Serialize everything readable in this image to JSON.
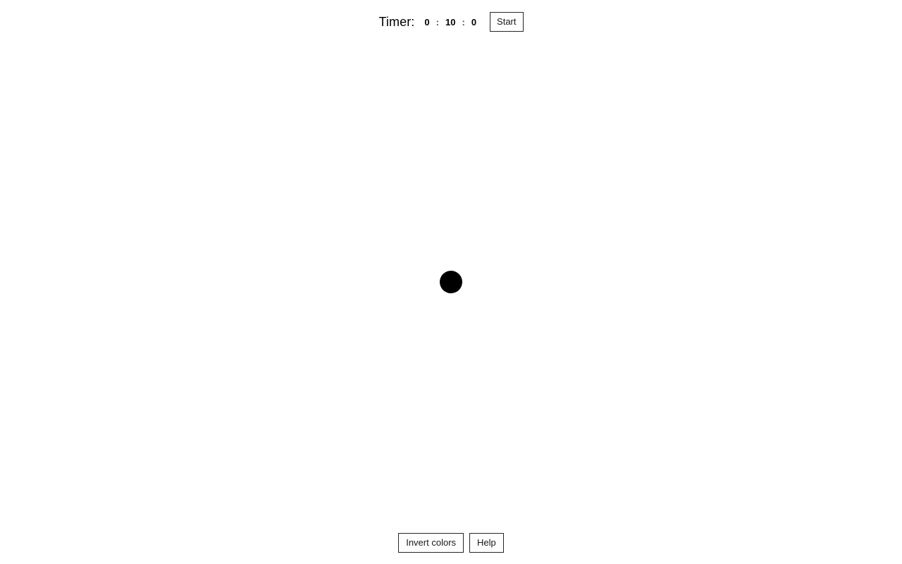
{
  "app": {
    "background_color": "#ffffff",
    "foreground_color": "#000000"
  },
  "timer": {
    "label": "Timer:",
    "hours": "0",
    "separator_1": ":",
    "minutes": "10",
    "separator_2": ":",
    "seconds": "0",
    "start_label": "Start"
  },
  "canvas": {
    "dot": {
      "color": "#000000",
      "diameter": "32",
      "center_x": "640",
      "center_y": "400"
    }
  },
  "controls": {
    "invert_label": "Invert colors",
    "help_label": "Help"
  }
}
